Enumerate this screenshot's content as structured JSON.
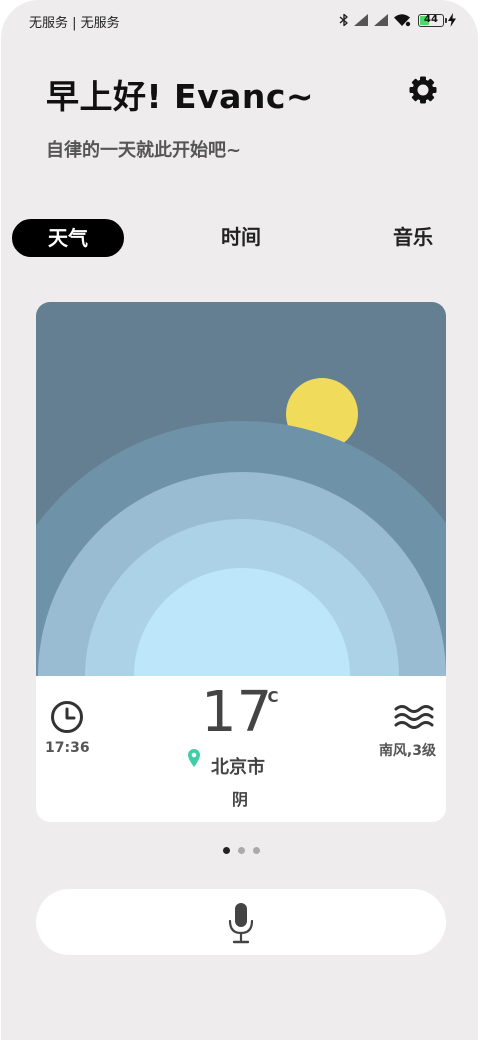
{
  "status_bar": {
    "carrier": "无服务 | 无服务",
    "battery_level": "44",
    "battery_fraction": 0.44,
    "icons": [
      "bluetooth-icon",
      "signal-icon",
      "signal-icon",
      "wifi-icon",
      "battery-icon",
      "charging-icon"
    ]
  },
  "header": {
    "greeting": "早上好! Evanc~",
    "subtitle": "自律的一天就此开始吧~",
    "settings_icon": "gear-icon"
  },
  "tabs": [
    {
      "label": "天气",
      "active": true
    },
    {
      "label": "时间",
      "active": false
    },
    {
      "label": "音乐",
      "active": false
    }
  ],
  "weather": {
    "time": "17:36",
    "temperature": "17",
    "unit": "°C",
    "city": "北京市",
    "condition": "阴",
    "wind": "南风,3级",
    "colors": {
      "sky": "#647f91",
      "sun": "#f0dc5a",
      "ring1": "#6e92a8",
      "ring2": "#99bcd2",
      "ring3": "#acd2e8",
      "ring4": "#bde6fb",
      "pin": "#3fcfa8"
    }
  },
  "pager": {
    "count": 3,
    "active": 1
  },
  "voice": {
    "icon": "microphone-icon"
  }
}
